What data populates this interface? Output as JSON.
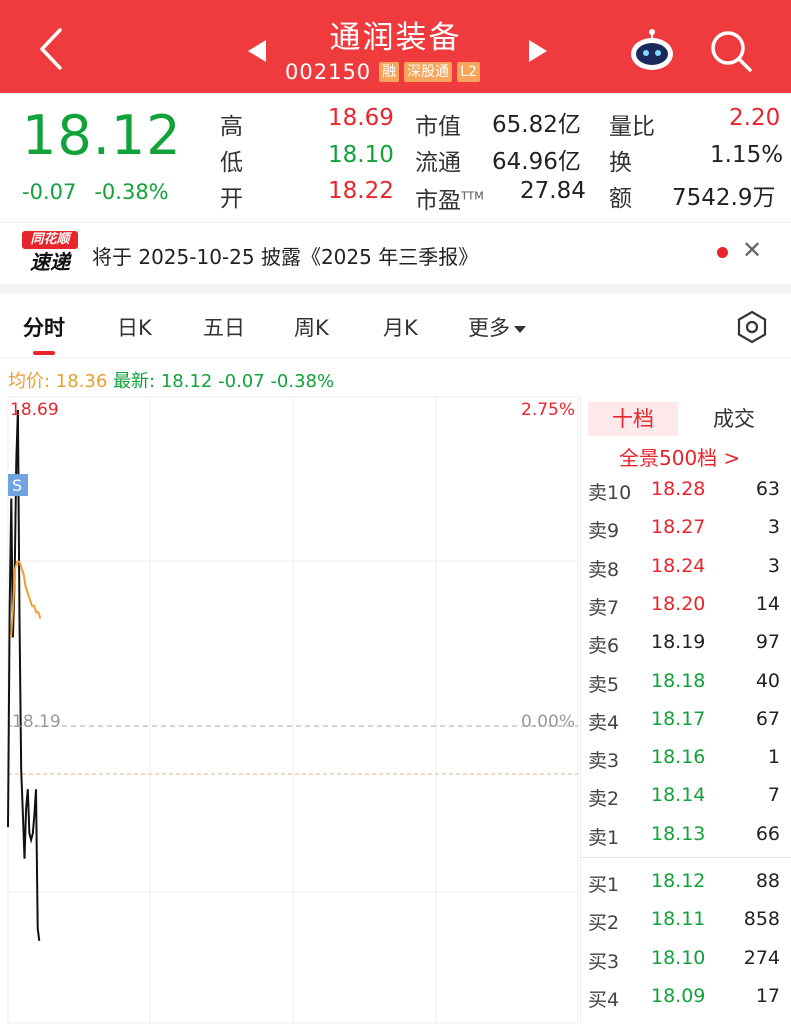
{
  "header": {
    "title": "通润装备",
    "code": "002150",
    "tags": [
      "融",
      "深股通",
      "L2"
    ]
  },
  "quote": {
    "price": "18.12",
    "change": "-0.07",
    "change_pct": "-0.38%",
    "stats": [
      {
        "label": "高",
        "value": "18.69"
      },
      {
        "label": "低",
        "value": "18.10"
      },
      {
        "label": "开",
        "value": "18.22"
      },
      {
        "label": "市值",
        "value": "65.82亿"
      },
      {
        "label": "流通",
        "value": "64.96亿"
      },
      {
        "label": "市盈",
        "sup": "TTM",
        "value": "27.84"
      },
      {
        "label": "量比",
        "value": "2.20"
      },
      {
        "label": "换",
        "value": "1.15%"
      },
      {
        "label": "额",
        "value": "7542.9万"
      }
    ]
  },
  "notice": {
    "logo_top": "同花顺",
    "logo_bottom": "速递",
    "text": "将于 2025-10-25 披露《2025 年三季报》"
  },
  "tabs": [
    "分时",
    "日K",
    "五日",
    "周K",
    "月K",
    "更多"
  ],
  "avg_info": {
    "avg": "均价: 18.36",
    "latest": "最新: 18.12",
    "change": "-0.07",
    "change_pct": "-0.38%"
  },
  "chart_data": {
    "type": "line",
    "price_top": "18.69",
    "pct_top": "2.75%",
    "price_mid": "18.19",
    "pct_mid": "0.00%",
    "marker": "S",
    "ylim": [
      17.69,
      18.69
    ],
    "prev_close": 18.19,
    "avg_price": 18.36,
    "series": [
      {
        "values": [
          18.03,
          18.38,
          18.55,
          18.33,
          18.42,
          18.61,
          18.69,
          18.36,
          18.12,
          18.05,
          17.98,
          18.06,
          18.09,
          18.02,
          18.01,
          18.02,
          18.05,
          18.09,
          17.87,
          17.85
        ]
      },
      {
        "values": [
          18.33,
          18.38,
          18.44,
          18.45,
          18.45,
          18.44,
          18.43,
          18.41,
          18.4,
          18.39,
          18.38,
          18.38,
          18.37,
          18.37,
          18.36
        ]
      }
    ]
  },
  "order_book": {
    "tab_active": "十档",
    "tab_other": "成交",
    "full_link": "全景500档 >",
    "asks": [
      {
        "label": "卖10",
        "price": "18.28",
        "vol": "63"
      },
      {
        "label": "卖9",
        "price": "18.27",
        "vol": "3"
      },
      {
        "label": "卖8",
        "price": "18.24",
        "vol": "3"
      },
      {
        "label": "卖7",
        "price": "18.20",
        "vol": "14"
      },
      {
        "label": "卖6",
        "price": "18.19",
        "vol": "97"
      },
      {
        "label": "卖5",
        "price": "18.18",
        "vol": "40"
      },
      {
        "label": "卖4",
        "price": "18.17",
        "vol": "67"
      },
      {
        "label": "卖3",
        "price": "18.16",
        "vol": "1"
      },
      {
        "label": "卖2",
        "price": "18.14",
        "vol": "7"
      },
      {
        "label": "卖1",
        "price": "18.13",
        "vol": "66"
      }
    ],
    "bids": [
      {
        "label": "买1",
        "price": "18.12",
        "vol": "88"
      },
      {
        "label": "买2",
        "price": "18.11",
        "vol": "858"
      },
      {
        "label": "买3",
        "price": "18.10",
        "vol": "274"
      },
      {
        "label": "买4",
        "price": "18.09",
        "vol": "17"
      }
    ]
  },
  "colors": {
    "up": "#e8252c",
    "down": "#12a23a",
    "header": "#ef3b3e",
    "avg": "#e8a030"
  }
}
